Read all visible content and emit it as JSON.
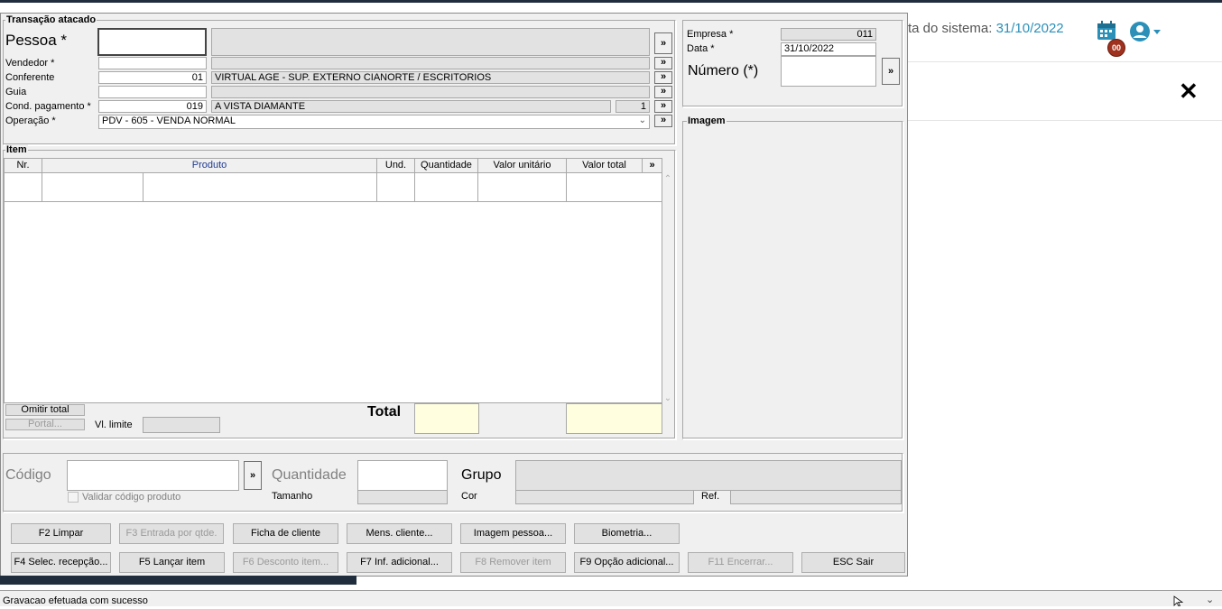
{
  "web": {
    "date_label": "ta do sistema:",
    "date_value": "31/10/2022",
    "badge": "00",
    "status_bar_text": "Gravacao efetuada com sucesso"
  },
  "dialog": {
    "top_group": {
      "title": "Transação atacado",
      "pessoa_label": "Pessoa *",
      "pessoa_value": "",
      "vendedor_label": "Vendedor *",
      "conferente_label": "Conferente",
      "conferente_code": "01",
      "conferente_name": "VIRTUAL AGE - SUP. EXTERNO CIANORTE / ESCRITORIOS",
      "guia_label": "Guia",
      "cond_label": "Cond. pagamento *",
      "cond_code": "019",
      "cond_name": "A VISTA DIAMANTE",
      "cond_parcelas": "1",
      "operacao_label": "Operação *",
      "operacao_value": "PDV - 605 - VENDA NORMAL",
      "more": "»"
    },
    "company_group": {
      "empresa_label": "Empresa *",
      "empresa_value": "011",
      "data_label": "Data *",
      "data_value": "31/10/2022",
      "numero_label": "Número (*)",
      "more": "»"
    },
    "image_group": {
      "title": "Imagem"
    },
    "item_group": {
      "title": "Item",
      "columns": [
        "Nr.",
        "Produto",
        "Und.",
        "Quantidade",
        "Valor unitário",
        "Valor total",
        "»"
      ],
      "omitir_total": "Omitir total",
      "portal": "Portal...",
      "vl_limite_label": "Vl. limite",
      "total_label": "Total"
    },
    "entry": {
      "codigo_label": "Código",
      "quantidade_label": "Quantidade",
      "grupo_label": "Grupo",
      "validar_label": "Validar código produto",
      "tamanho_label": "Tamanho",
      "cor_label": "Cor",
      "ref_label": "Ref.",
      "more": "»"
    },
    "buttons_row1": [
      {
        "label": "F2 Limpar",
        "enabled": true
      },
      {
        "label": "F3 Entrada por qtde.",
        "enabled": false
      },
      {
        "label": "Ficha de cliente",
        "enabled": true
      },
      {
        "label": "Mens. cliente...",
        "enabled": true
      },
      {
        "label": "Imagem pessoa...",
        "enabled": true
      },
      {
        "label": "Biometria...",
        "enabled": true
      }
    ],
    "buttons_row2": [
      {
        "label": "F4 Selec. recepção...",
        "enabled": true
      },
      {
        "label": "F5 Lançar item",
        "enabled": true
      },
      {
        "label": "F6 Desconto item...",
        "enabled": false
      },
      {
        "label": "F7 Inf. adicional...",
        "enabled": true
      },
      {
        "label": "F8 Remover item",
        "enabled": false
      },
      {
        "label": "F9 Opção adicional...",
        "enabled": true
      },
      {
        "label": "F11 Encerrar...",
        "enabled": false
      },
      {
        "label": "ESC Sair",
        "enabled": true
      }
    ]
  }
}
